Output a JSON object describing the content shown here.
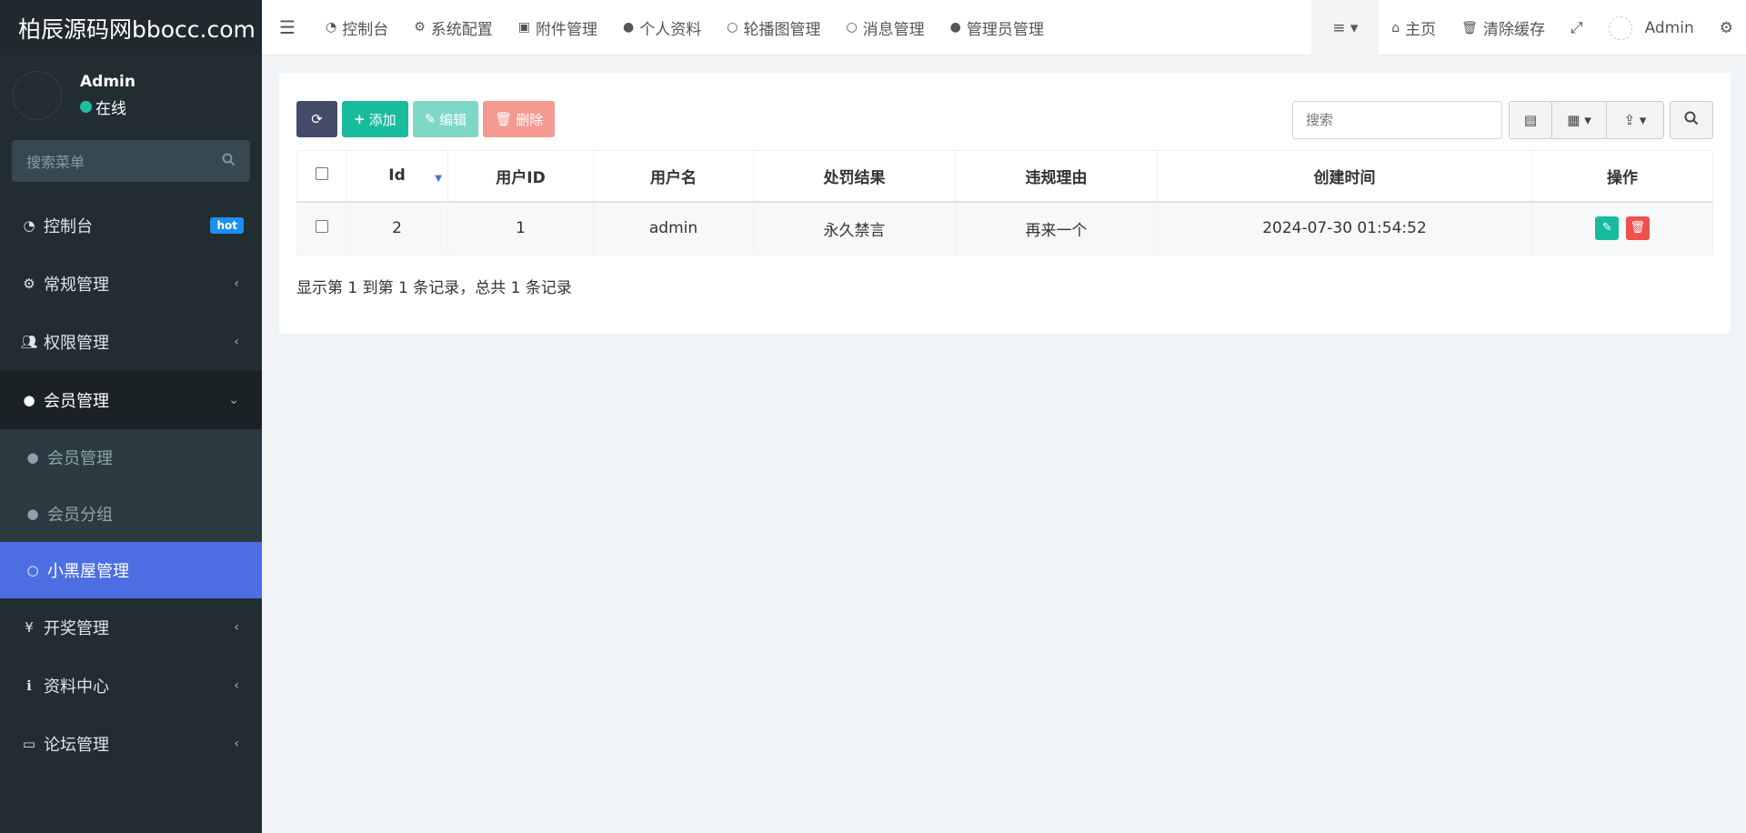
{
  "brand": "柏辰源码网bbocc.com",
  "user": {
    "name": "Admin",
    "status": "在线"
  },
  "sidebar": {
    "search_placeholder": "搜索菜单",
    "items": [
      {
        "label": "控制台",
        "badge": "hot"
      },
      {
        "label": "常规管理"
      },
      {
        "label": "权限管理"
      },
      {
        "label": "会员管理"
      },
      {
        "label": "开奖管理"
      },
      {
        "label": "资料中心"
      },
      {
        "label": "论坛管理"
      }
    ],
    "subitems": [
      {
        "label": "会员管理"
      },
      {
        "label": "会员分组"
      },
      {
        "label": "小黑屋管理"
      }
    ]
  },
  "topnav": {
    "links": [
      "控制台",
      "系统配置",
      "附件管理",
      "个人资料",
      "轮播图管理",
      "消息管理",
      "管理员管理"
    ],
    "right": {
      "home": "主页",
      "clear_cache": "清除缓存",
      "user": "Admin"
    }
  },
  "toolbar": {
    "add": "添加",
    "edit": "编辑",
    "delete": "删除",
    "search_placeholder": "搜索"
  },
  "table": {
    "headers": [
      "Id",
      "用户ID",
      "用户名",
      "处罚结果",
      "违规理由",
      "创建时间",
      "操作"
    ],
    "rows": [
      {
        "id": "2",
        "user_id": "1",
        "username": "admin",
        "result": "永久禁言",
        "reason": "再来一个",
        "created": "2024-07-30 01:54:52"
      }
    ]
  },
  "pager": "显示第 1 到第 1 条记录，总共 1 条记录",
  "colors": {
    "sidebar_bg": "#222d32",
    "active_item": "#4d6ee3",
    "primary_green": "#18bc9c",
    "danger": "#f05050",
    "badge_blue": "#1c8ff0"
  }
}
